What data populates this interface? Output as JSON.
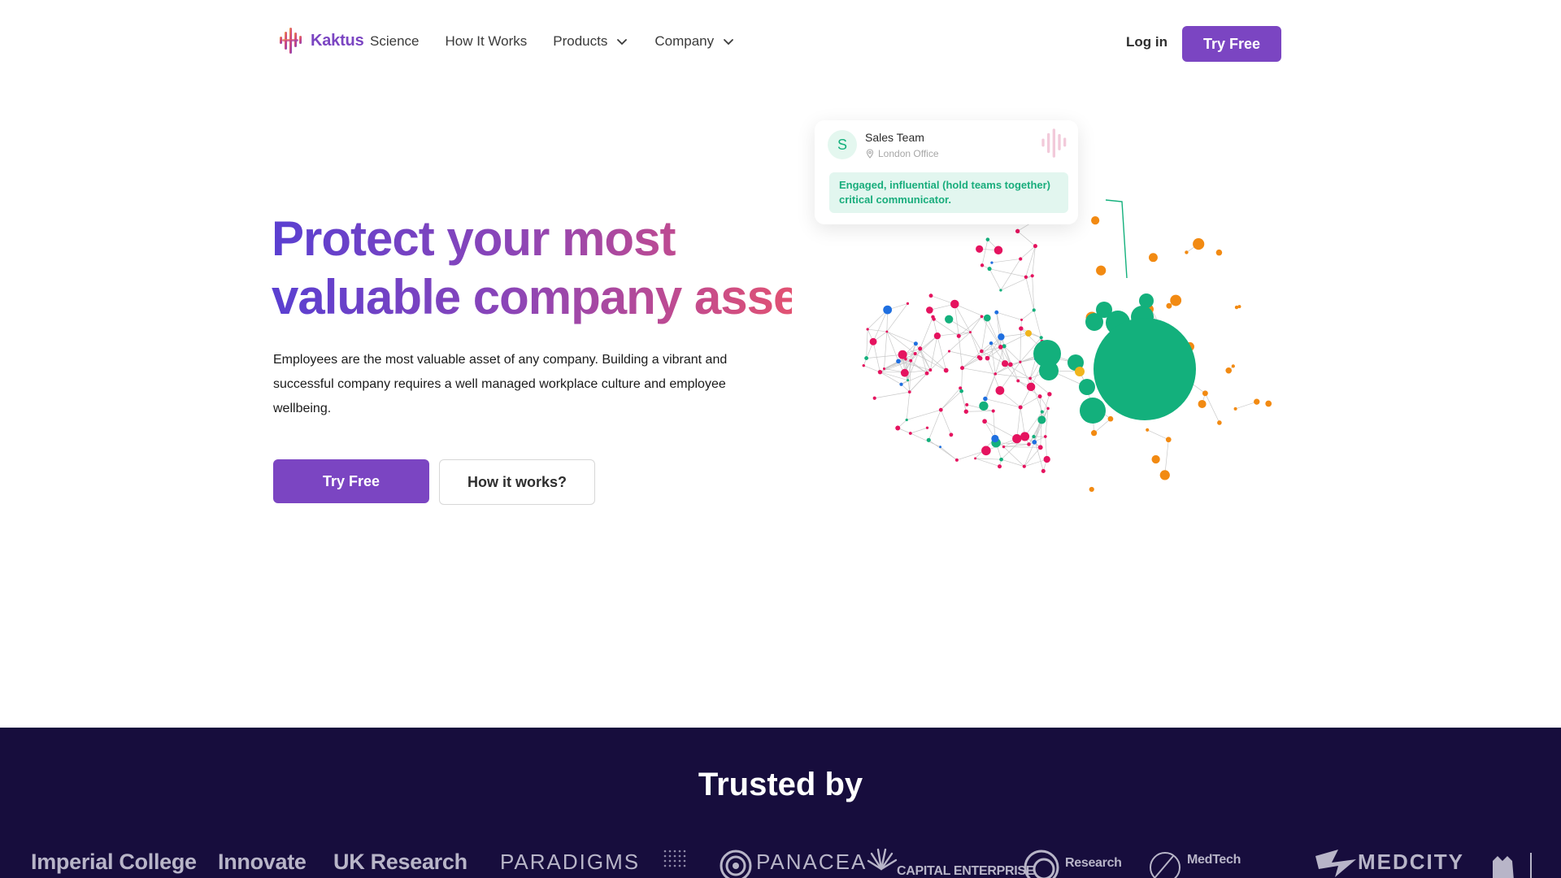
{
  "brand": {
    "name": "Kaktus",
    "accent": "#7b45c2"
  },
  "nav": {
    "links": [
      {
        "label": "Science"
      },
      {
        "label": "How It Works"
      },
      {
        "label": "Products",
        "dropdown": true
      },
      {
        "label": "Company",
        "dropdown": true
      }
    ],
    "login": "Log in",
    "cta": "Try Free"
  },
  "hero": {
    "title_line1": "Protect your most",
    "title_line2": "valuable company asset",
    "description": "Employees are the most valuable asset of any company. Building a vibrant and successful company requires a well managed workplace culture and employee wellbeing.",
    "primary_button": "Try Free",
    "secondary_button": "How it works?"
  },
  "team_card": {
    "avatar_letter": "S",
    "team": "Sales Team",
    "location": "London Office",
    "tag_line1": "Engaged, influential (hold teams together)",
    "tag_line2": "critical communicator."
  },
  "network_colors": {
    "pink": "#e5135f",
    "green": "#13b07c",
    "orange": "#f28a12",
    "blue": "#1f6fe0",
    "yellow": "#f1b51c"
  },
  "trusted": {
    "title": "Trusted by",
    "logos": [
      "Imperial College",
      "Innovate",
      "UK Research",
      "PARADIGMS",
      "PANACEA",
      "CAPITAL ENTERPRISE",
      "Research",
      "MedTech",
      "MEDCITY"
    ]
  }
}
